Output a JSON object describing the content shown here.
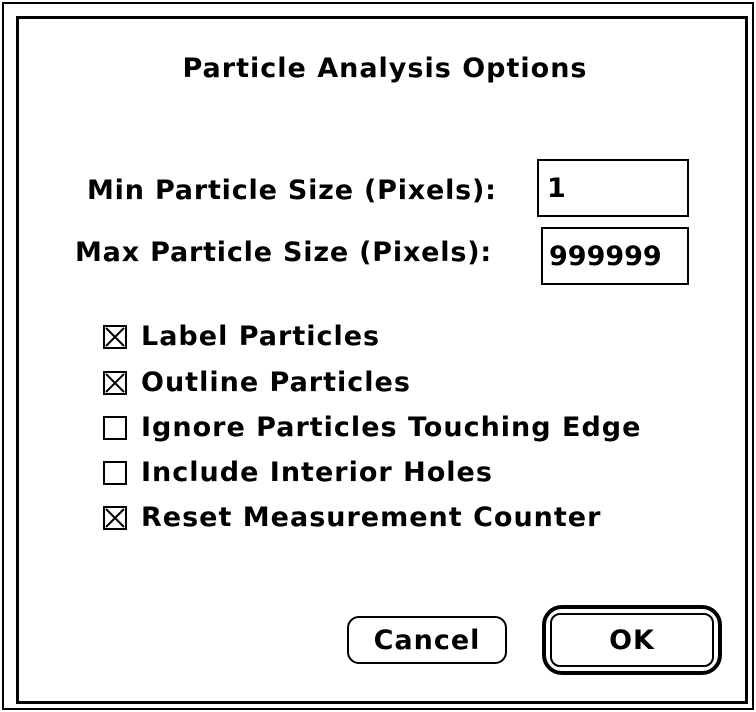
{
  "dialog": {
    "title": "Particle Analysis Options",
    "min_size": {
      "label": "Min Particle Size (Pixels):",
      "value": "1"
    },
    "max_size": {
      "label": "Max Particle Size (Pixels):",
      "value": "999999"
    },
    "options": [
      {
        "label": "Label Particles",
        "checked": true
      },
      {
        "label": "Outline Particles",
        "checked": true
      },
      {
        "label": "Ignore Particles Touching Edge",
        "checked": false
      },
      {
        "label": "Include Interior Holes",
        "checked": false
      },
      {
        "label": "Reset Measurement Counter",
        "checked": true
      }
    ],
    "cancel_label": "Cancel",
    "ok_label": "OK"
  }
}
